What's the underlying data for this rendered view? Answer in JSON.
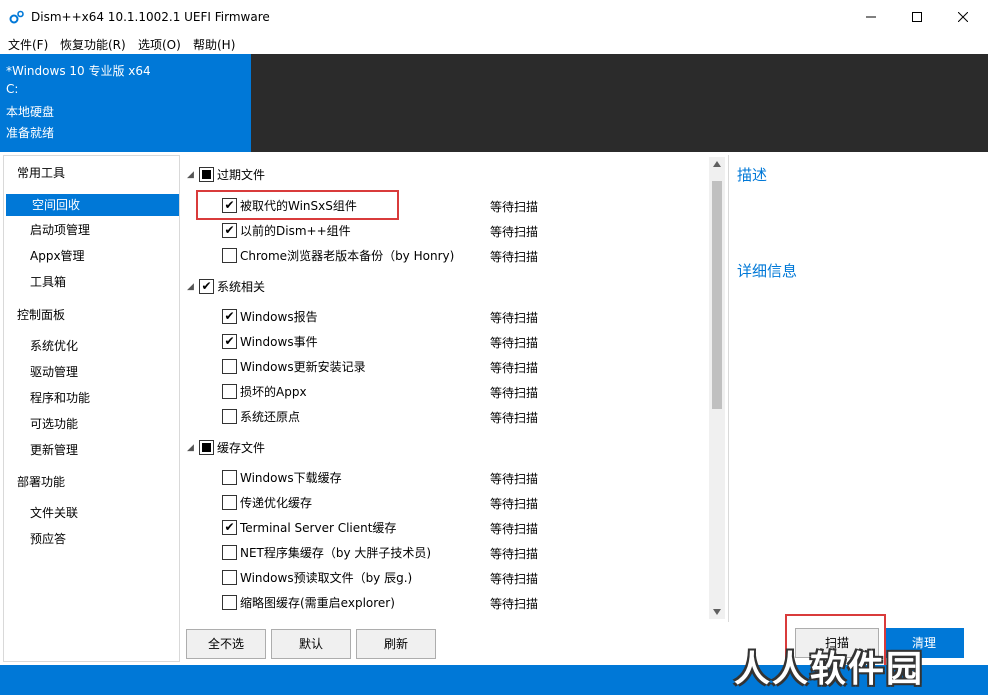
{
  "window": {
    "title": "Dism++x64 10.1.1002.1 UEFI Firmware"
  },
  "menu": [
    "文件(F)",
    "恢复功能(R)",
    "选项(O)",
    "帮助(H)"
  ],
  "session": {
    "os": "*Windows 10 专业版 x64",
    "drive": "C:",
    "disk_type": "本地硬盘",
    "status": "准备就绪"
  },
  "sidebar": {
    "groups": [
      {
        "label": "常用工具",
        "items": [
          "空间回收",
          "启动项管理",
          "Appx管理",
          "工具箱"
        ]
      },
      {
        "label": "控制面板",
        "items": [
          "系统优化",
          "驱动管理",
          "程序和功能",
          "可选功能",
          "更新管理"
        ]
      },
      {
        "label": "部署功能",
        "items": [
          "文件关联",
          "预应答"
        ]
      }
    ],
    "selected": "空间回收"
  },
  "cleanup": {
    "groups": [
      {
        "label": "过期文件",
        "state": "partial",
        "items": [
          {
            "label": "被取代的WinSxS组件",
            "checked": true,
            "status": "等待扫描"
          },
          {
            "label": "以前的Dism++组件",
            "checked": true,
            "status": "等待扫描"
          },
          {
            "label": "Chrome浏览器老版本备份（by Honry)",
            "checked": false,
            "status": "等待扫描"
          }
        ]
      },
      {
        "label": "系统相关",
        "state": "checked",
        "items": [
          {
            "label": "Windows报告",
            "checked": true,
            "status": "等待扫描"
          },
          {
            "label": "Windows事件",
            "checked": true,
            "status": "等待扫描"
          },
          {
            "label": "Windows更新安装记录",
            "checked": false,
            "status": "等待扫描"
          },
          {
            "label": "损坏的Appx",
            "checked": false,
            "status": "等待扫描"
          },
          {
            "label": "系统还原点",
            "checked": false,
            "status": "等待扫描"
          }
        ]
      },
      {
        "label": "缓存文件",
        "state": "partial",
        "items": [
          {
            "label": "Windows下载缓存",
            "checked": false,
            "status": "等待扫描"
          },
          {
            "label": "传递优化缓存",
            "checked": false,
            "status": "等待扫描"
          },
          {
            "label": "Terminal Server Client缓存",
            "checked": true,
            "status": "等待扫描"
          },
          {
            "label": "NET程序集缓存（by 大胖子技术员)",
            "checked": false,
            "status": "等待扫描"
          },
          {
            "label": "Windows预读取文件（by 辰g.)",
            "checked": false,
            "status": "等待扫描"
          },
          {
            "label": "缩略图缓存(需重启explorer)",
            "checked": false,
            "status": "等待扫描"
          }
        ]
      }
    ]
  },
  "details": {
    "description_title": "描述",
    "info_title": "详细信息"
  },
  "buttons": {
    "select_none": "全不选",
    "default": "默认",
    "refresh": "刷新",
    "scan": "扫描",
    "clean": "清理"
  },
  "watermark": "人人软件园",
  "colors": {
    "accent": "#0078d7",
    "header_dark": "#2b2b2b",
    "highlight_box": "#d93b3b"
  }
}
